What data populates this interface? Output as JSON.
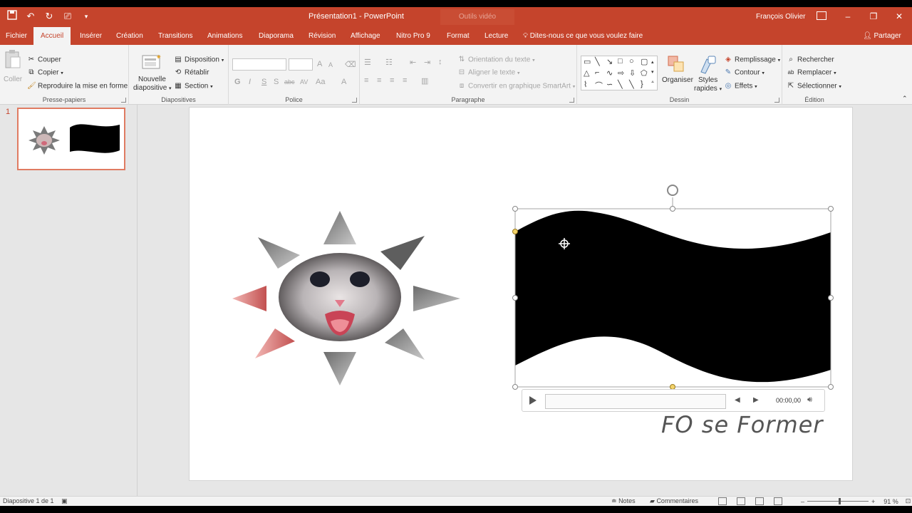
{
  "titlebar": {
    "document_title": "Présentation1 - PowerPoint",
    "context_tab": "Outils vidéo",
    "user": "François Olivier",
    "qat": {
      "save": "save-icon",
      "undo": "undo-icon",
      "redo": "redo-icon",
      "customize": "customize-icon"
    },
    "window": {
      "minimize": "–",
      "restore": "❐",
      "close": "✕"
    }
  },
  "tabs": [
    {
      "label": "Fichier"
    },
    {
      "label": "Accueil"
    },
    {
      "label": "Insérer"
    },
    {
      "label": "Création"
    },
    {
      "label": "Transitions"
    },
    {
      "label": "Animations"
    },
    {
      "label": "Diaporama"
    },
    {
      "label": "Révision"
    },
    {
      "label": "Affichage"
    },
    {
      "label": "Nitro Pro 9"
    },
    {
      "label": "Format"
    },
    {
      "label": "Lecture"
    }
  ],
  "tell_me": "Dites-nous ce que vous voulez faire",
  "share": "Partager",
  "ribbon": {
    "clipboard": {
      "label": "Presse-papiers",
      "paste": "Coller",
      "cut": "Couper",
      "copy": "Copier",
      "format_painter": "Reproduire la mise en forme"
    },
    "slides": {
      "label": "Diapositives",
      "new_slide_1": "Nouvelle",
      "new_slide_2": "diapositive",
      "layout": "Disposition",
      "reset": "Rétablir",
      "section": "Section"
    },
    "font": {
      "label": "Police",
      "bold": "G",
      "italic": "I",
      "underline": "S",
      "shadow": "S",
      "strike": "abc",
      "spacing": "AV",
      "case": "Aa",
      "grow": "A",
      "shrink": "A",
      "color": "A"
    },
    "paragraph": {
      "label": "Paragraphe",
      "text_direction": "Orientation du texte",
      "align_text": "Aligner le texte",
      "smartart": "Convertir en graphique SmartArt"
    },
    "drawing": {
      "label": "Dessin",
      "arrange": "Organiser",
      "quick_styles_1": "Styles",
      "quick_styles_2": "rapides",
      "fill": "Remplissage",
      "outline": "Contour",
      "effects": "Effets"
    },
    "editing": {
      "label": "Édition",
      "find": "Rechercher",
      "replace": "Remplacer",
      "select": "Sélectionner"
    }
  },
  "thumbnails": [
    {
      "number": "1"
    }
  ],
  "media": {
    "time": "00:00,00"
  },
  "watermark": "FO se Former",
  "status": {
    "slide_info": "Diapositive 1 de 1",
    "notes": "Notes",
    "comments": "Commentaires",
    "zoom": "91 %",
    "zoom_level_percent": 91
  },
  "colors": {
    "accent": "#c5442c",
    "ribbon": "#f3f3f3",
    "canvas": "#e6e6e6"
  }
}
